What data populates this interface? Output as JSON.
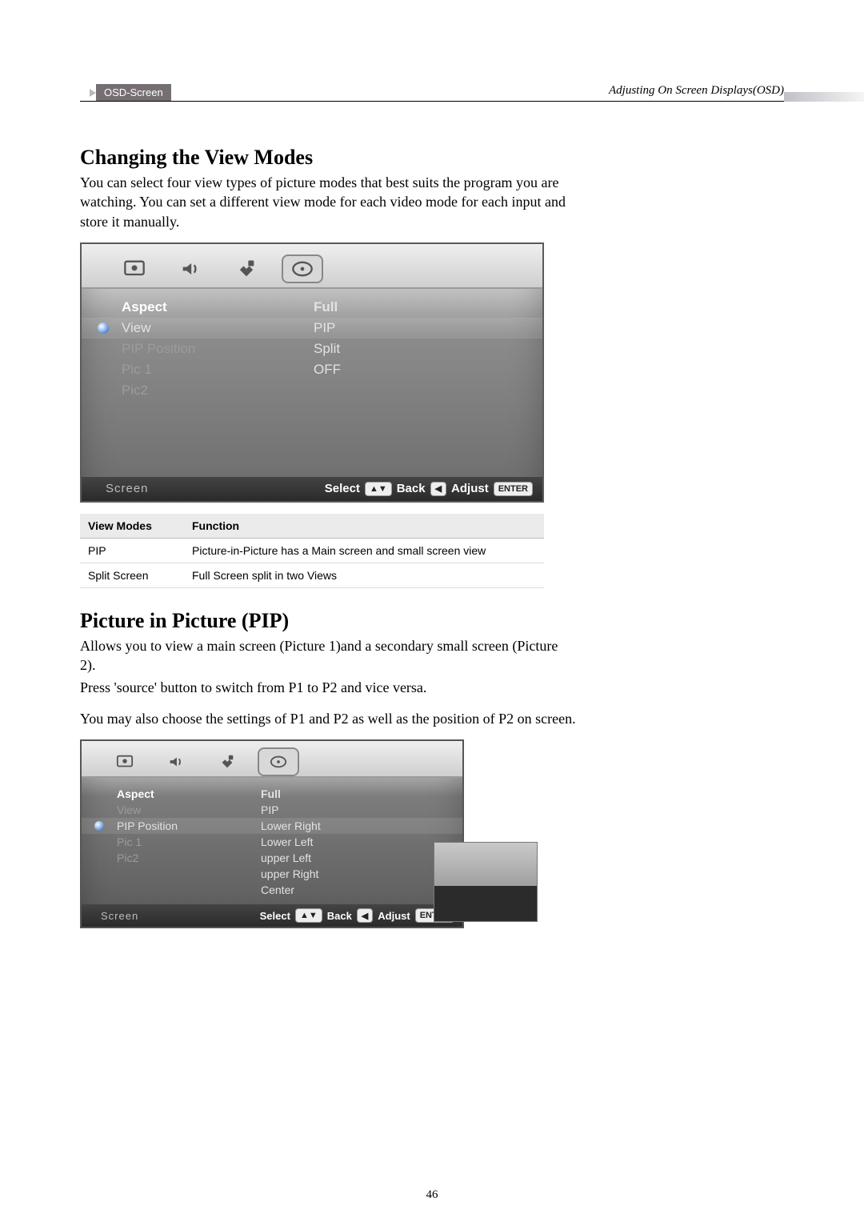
{
  "header": {
    "pill": "OSD-Screen",
    "right": "Adjusting On Screen Displays(OSD)"
  },
  "section1": {
    "title": "Changing the View Modes",
    "body": "You can select four view types of picture modes that best suits the program you are watching. You can set a different view mode for each video mode for each input and store it manually."
  },
  "osd1": {
    "rows": [
      {
        "label": "Aspect",
        "val": "Full",
        "top": true
      },
      {
        "label": "View",
        "val": "PIP",
        "sel": true
      },
      {
        "label": "PIP Position",
        "val": "Split",
        "dim": true
      },
      {
        "label": "Pic 1",
        "val": "OFF",
        "dim": true
      },
      {
        "label": "Pic2",
        "val": "",
        "dim": true
      }
    ],
    "footer_title": "Screen",
    "footer": {
      "select": "Select",
      "back": "Back",
      "adjust": "Adjust",
      "enter": "ENTER",
      "updown": "▲▼",
      "left": "◀"
    }
  },
  "table": {
    "headers": [
      "View Modes",
      "Function"
    ],
    "rows": [
      [
        "PIP",
        "Picture-in-Picture has  a Main screen and small screen view"
      ],
      [
        "Split Screen",
        "Full Screen split in two Views"
      ]
    ]
  },
  "section2": {
    "title": "Picture in Picture (PIP)",
    "body1": "Allows you to view a main screen (Picture 1)and a secondary small screen (Picture 2).",
    "body2": "Press 'source' button to switch from P1 to P2 and vice versa.",
    "body3": "You may also choose the settings of P1 and P2 as well as the position of P2 on screen."
  },
  "osd2": {
    "rows": [
      {
        "label": "Aspect",
        "val": "Full",
        "top": true
      },
      {
        "label": "View",
        "val": "PIP",
        "dim": true
      },
      {
        "label": "PIP Position",
        "val": "Lower Right",
        "sel": true
      },
      {
        "label": "Pic 1",
        "val": "Lower Left",
        "dim": true
      },
      {
        "label": "Pic2",
        "val": "upper Left",
        "dim": true
      },
      {
        "label": "",
        "val": "upper Right",
        "dim": true
      },
      {
        "label": "",
        "val": "Center",
        "dim": true
      }
    ],
    "footer_title": "Screen",
    "footer": {
      "select": "Select",
      "back": "Back",
      "adjust": "Adjust",
      "enter": "ENTER",
      "updown": "▲▼",
      "left": "◀"
    }
  },
  "page_number": "46"
}
